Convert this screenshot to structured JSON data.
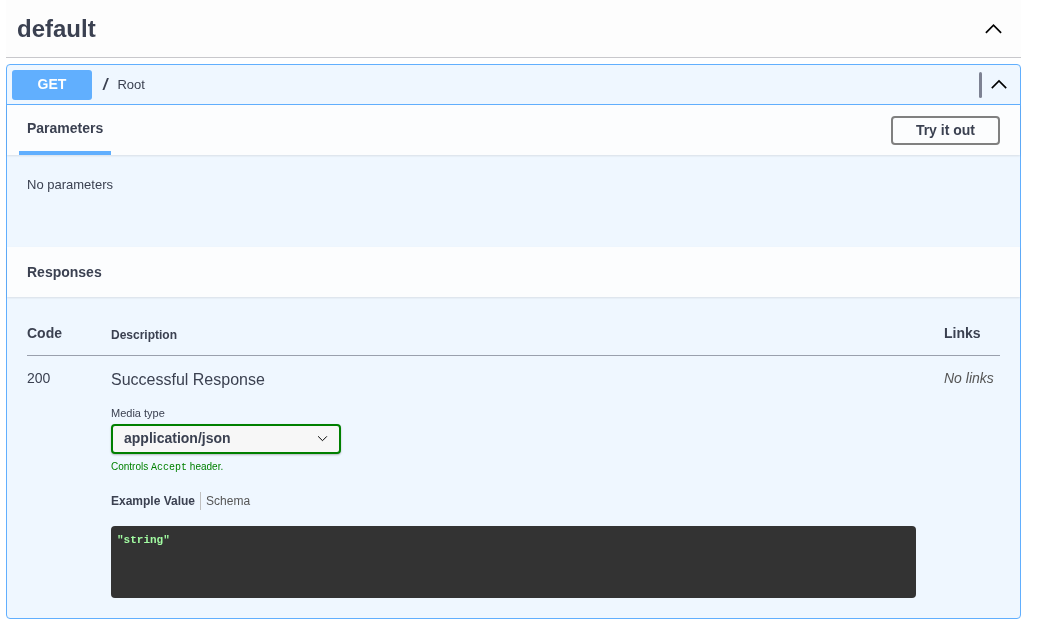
{
  "tag": {
    "name": "default",
    "expanded": true
  },
  "operation": {
    "method": "GET",
    "path": "/",
    "summary": "Root",
    "expanded": true
  },
  "parameters": {
    "tabs": [
      {
        "label": "Parameters",
        "selected": true
      }
    ],
    "try_button": "Try it out",
    "empty_text": "No parameters"
  },
  "responses": {
    "title": "Responses",
    "columns": [
      "Code",
      "Description",
      "Links"
    ],
    "rows": [
      {
        "code": "200",
        "description": "Successful Response",
        "media_type_label": "Media type",
        "media_type": "application/json",
        "note": {
          "before": "Controls",
          "code": "Accept",
          "after": "header."
        },
        "example_tabs": [
          {
            "label": "Example Value",
            "selected": true
          },
          {
            "label": "Schema",
            "selected": false
          }
        ],
        "example": "\"string\"",
        "links": "No links"
      }
    ]
  }
}
